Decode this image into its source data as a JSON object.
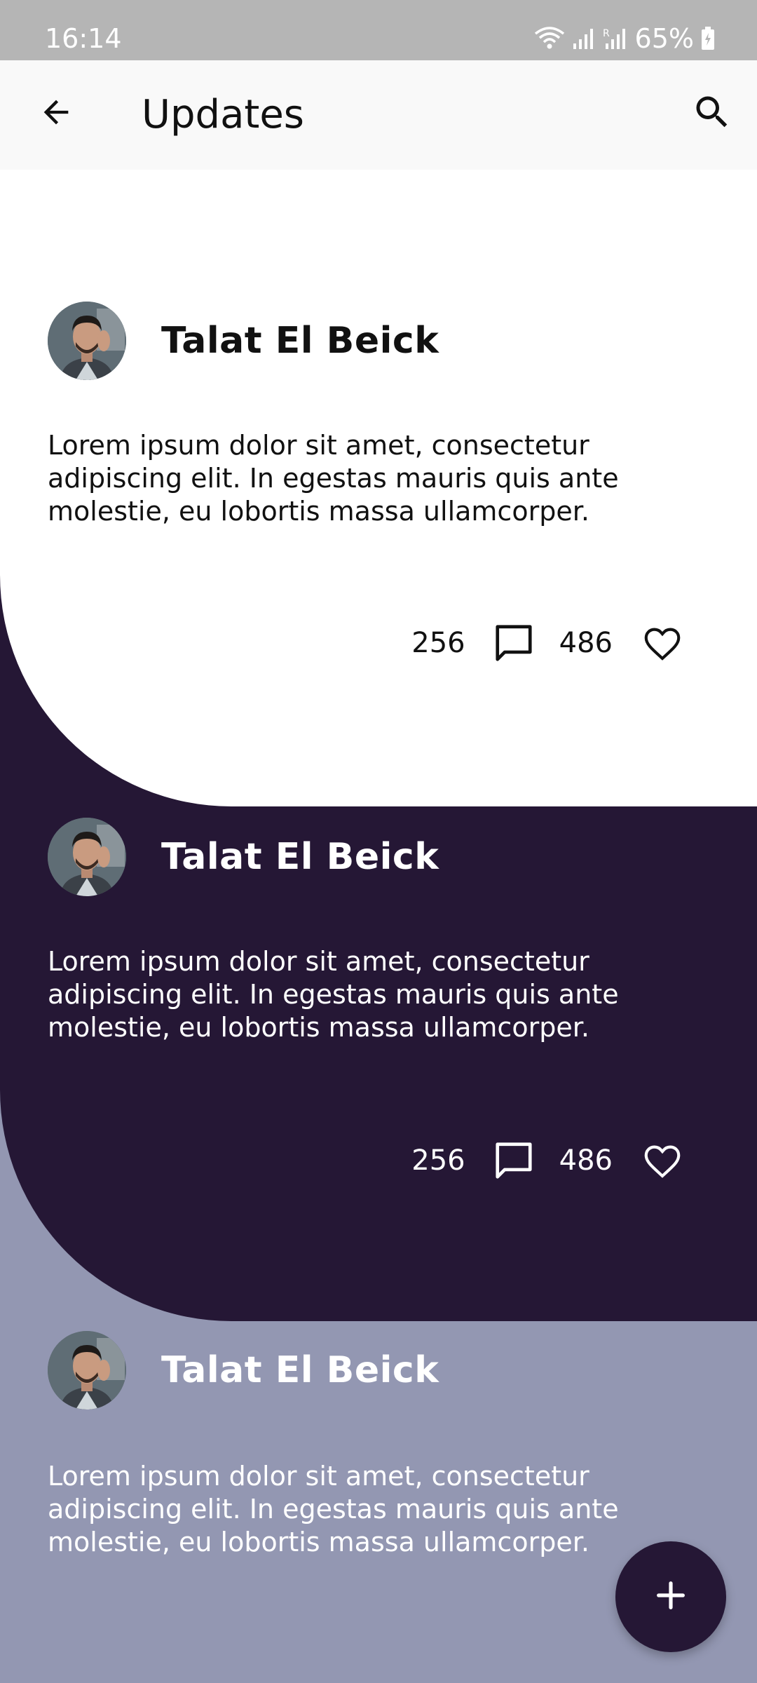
{
  "status_bar": {
    "time": "16:14",
    "battery": "65%",
    "icons": [
      "wifi-icon",
      "signal-icon",
      "signal-r-icon",
      "battery-icon"
    ]
  },
  "app_bar": {
    "title": "Updates",
    "back_icon": "arrow-left-icon",
    "search_icon": "search-icon"
  },
  "posts": [
    {
      "author": "Talat El Beick",
      "body": "Lorem ipsum dolor sit amet, consectetur adipiscing elit. In egestas mauris quis ante molestie, eu lobortis massa ullamcorper.",
      "comments": "256",
      "likes": "486"
    },
    {
      "author": "Talat El Beick",
      "body": "Lorem ipsum dolor sit amet, consectetur adipiscing elit. In egestas mauris quis ante molestie, eu lobortis massa ullamcorper.",
      "comments": "256",
      "likes": "486"
    },
    {
      "author": "Talat El Beick",
      "body": "Lorem ipsum dolor sit amet, consectetur adipiscing elit. In egestas mauris quis ante molestie, eu lobortis massa ullamcorper."
    }
  ],
  "fab": {
    "icon": "plus-icon"
  },
  "colors": {
    "card_1": "#ffffff",
    "card_2": "#251735",
    "card_3": "#9397b2",
    "status_bar": "#b5b5b5",
    "fab": "#251735"
  }
}
